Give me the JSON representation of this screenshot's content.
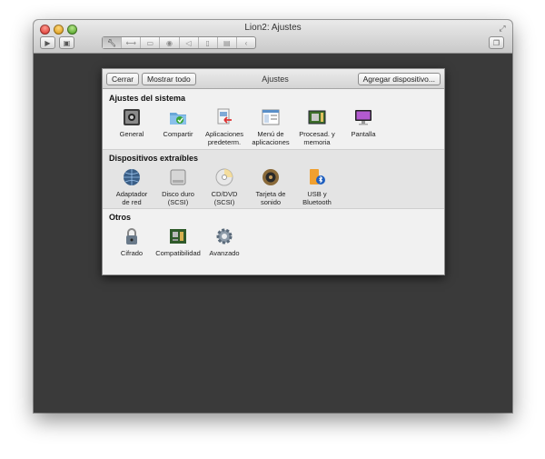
{
  "window": {
    "title": "Lion2: Ajustes"
  },
  "toolbar": {
    "play_icon": "play-icon",
    "snapshot_icon": "snapshot-icon",
    "segments": [
      "wrench-icon",
      "network-icon",
      "disk-icon",
      "camera-icon",
      "sound-icon",
      "usb-icon",
      "drive-icon",
      "arrow-icon"
    ],
    "window_icon": "window-icon"
  },
  "panel": {
    "title": "Ajustes",
    "close_label": "Cerrar",
    "show_all_label": "Mostrar todo",
    "add_device_label": "Agregar dispositivo..."
  },
  "sections": {
    "system": {
      "title": "Ajustes del sistema",
      "items": [
        {
          "label": "General",
          "icon": "general-icon"
        },
        {
          "label": "Compartir",
          "icon": "shared-folder-icon"
        },
        {
          "label": "Aplicaciones\npredeterm.",
          "icon": "default-apps-icon"
        },
        {
          "label": "Menú de\naplicaciones",
          "icon": "app-menu-icon"
        },
        {
          "label": "Procesad. y\nmemoria",
          "icon": "processor-icon"
        },
        {
          "label": "Pantalla",
          "icon": "display-icon"
        }
      ]
    },
    "removable": {
      "title": "Dispositivos extraíbles",
      "items": [
        {
          "label": "Adaptador\nde red",
          "icon": "network-globe-icon"
        },
        {
          "label": "Disco duro\n(SCSI)",
          "icon": "hard-disk-icon"
        },
        {
          "label": "CD/DVD\n(SCSI)",
          "icon": "cd-dvd-icon"
        },
        {
          "label": "Tarjeta de\nsonido",
          "icon": "speaker-icon"
        },
        {
          "label": "USB y\nBluetooth",
          "icon": "usb-bluetooth-icon"
        }
      ]
    },
    "others": {
      "title": "Otros",
      "items": [
        {
          "label": "Cifrado",
          "icon": "padlock-icon"
        },
        {
          "label": "Compatibilidad",
          "icon": "chip-icon"
        },
        {
          "label": "Avanzado",
          "icon": "gear-icon"
        }
      ]
    }
  }
}
